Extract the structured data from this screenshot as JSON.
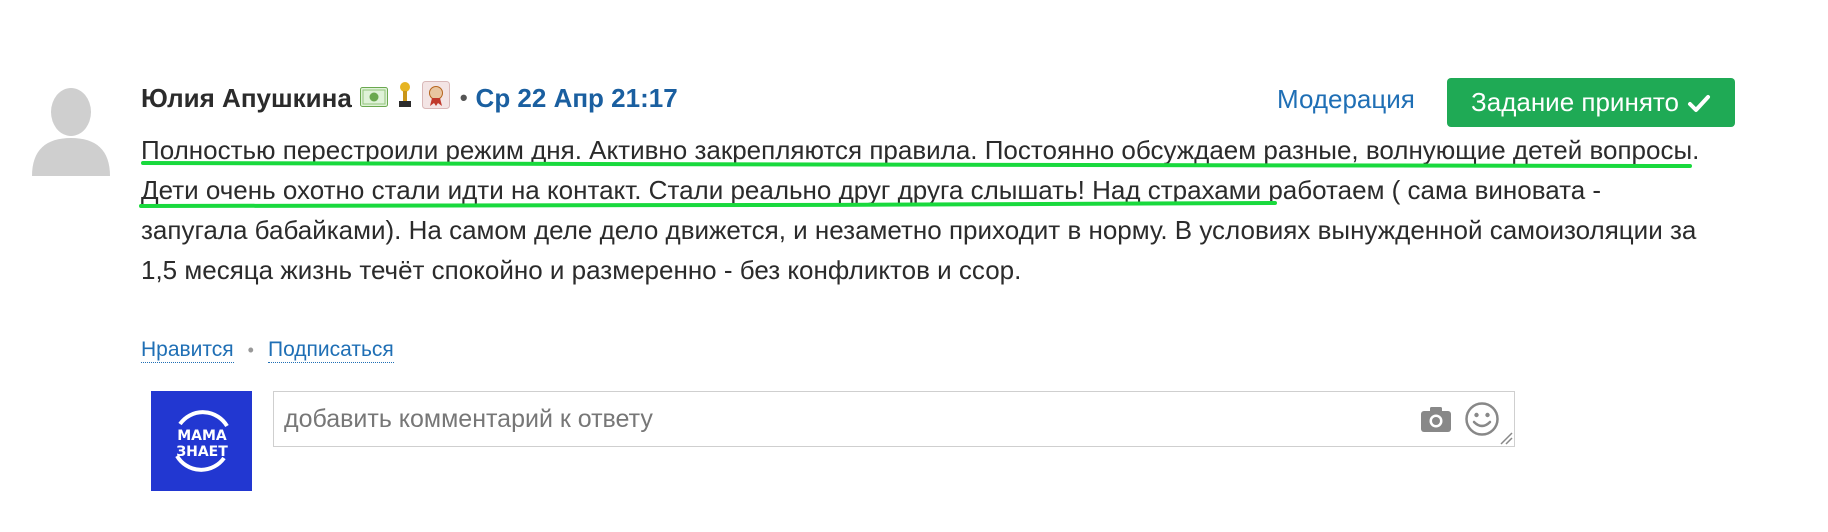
{
  "post": {
    "author": "Юлия Апушкина",
    "separator": "•",
    "timestamp": "Ср 22 Апр 21:17",
    "moderation_label": "Модерация",
    "accepted_label": "Задание принято",
    "text": "Полностью перестроили режим дня. Активно закрепляются правила. Постоянно обсуждаем разные, волнующие детей вопросы. Дети очень охотно стали идти на контакт. Стали реально друг друга слышать! Над страхами работаем ( сама виновата - запугала бабайками). На самом деле дело движется, и незаметно приходит в норму. В условиях вынужденной самоизоляции за 1,5 месяца жизнь течёт спокойно и размеренно - без конфликтов и ссор.",
    "highlight_color": "#19d93d",
    "badges": [
      "money-badge-icon",
      "trophy-badge-icon",
      "medal-badge-icon"
    ]
  },
  "actions": {
    "like_label": "Нравится",
    "separator": "•",
    "subscribe_label": "Подписаться"
  },
  "comment": {
    "placeholder": "добавить комментарий к ответу",
    "logo_text_top": "МАМА",
    "logo_text_bottom": "ЗНАЕТ"
  },
  "colors": {
    "accent_blue": "#1f6fb5",
    "accepted_green": "#1faa55",
    "logo_blue": "#2237d1"
  }
}
